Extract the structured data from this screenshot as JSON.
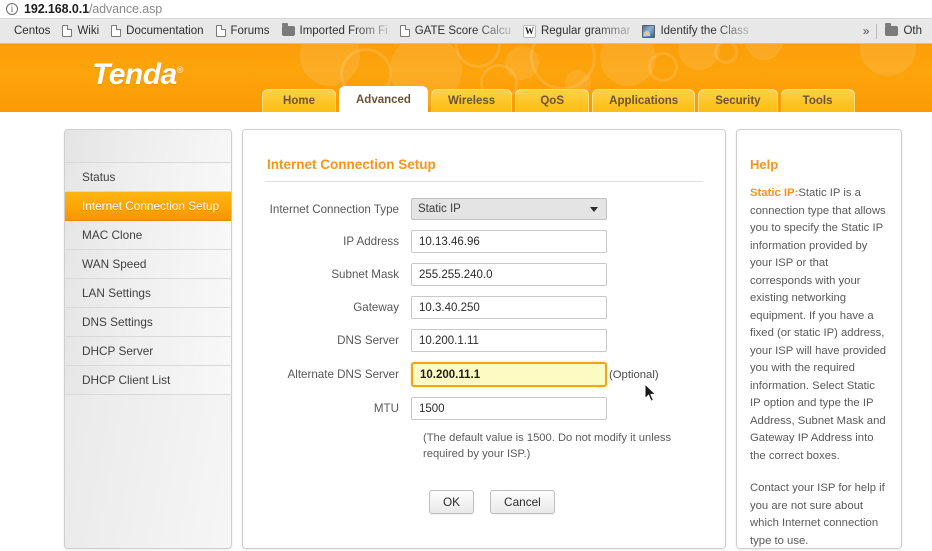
{
  "browser": {
    "url_host": "192.168.0.1",
    "url_path": "/advance.asp",
    "info_icon": "info-circle-icon",
    "bookmarks": [
      {
        "label": "Centos",
        "icon": "none"
      },
      {
        "label": "Wiki",
        "icon": "page-icon"
      },
      {
        "label": "Documentation",
        "icon": "page-icon"
      },
      {
        "label": "Forums",
        "icon": "page-icon"
      },
      {
        "label": "Imported From Fi",
        "icon": "folder-icon",
        "truncated": true
      },
      {
        "label": "GATE Score Calcu",
        "icon": "page-icon",
        "truncated": true
      },
      {
        "label": "Regular grammar",
        "icon": "wikipedia-icon",
        "truncated": true
      },
      {
        "label": "Identify the Class",
        "icon": "photo-icon",
        "truncated": true
      }
    ],
    "overflow_label": "»",
    "other_bookmarks_label": "Oth",
    "other_bookmarks_icon": "folder-icon"
  },
  "header": {
    "logo_text": "Tenda",
    "logo_trademark": "®",
    "tabs": [
      {
        "label": "Home",
        "active": false
      },
      {
        "label": "Advanced",
        "active": true
      },
      {
        "label": "Wireless",
        "active": false
      },
      {
        "label": "QoS",
        "active": false
      },
      {
        "label": "Applications",
        "active": false
      },
      {
        "label": "Security",
        "active": false
      },
      {
        "label": "Tools",
        "active": false
      }
    ]
  },
  "sidebar": {
    "items": [
      {
        "label": "Status",
        "active": false
      },
      {
        "label": "Internet Connection Setup",
        "active": true
      },
      {
        "label": "MAC Clone",
        "active": false
      },
      {
        "label": "WAN Speed",
        "active": false
      },
      {
        "label": "LAN Settings",
        "active": false
      },
      {
        "label": "DNS Settings",
        "active": false
      },
      {
        "label": "DHCP Server",
        "active": false
      },
      {
        "label": "DHCP Client List",
        "active": false
      }
    ]
  },
  "main": {
    "section_title": "Internet Connection Setup",
    "fields": {
      "connection_type": {
        "label": "Internet Connection Type",
        "value": "Static IP",
        "options": [
          "Static IP"
        ]
      },
      "ip_address": {
        "label": "IP Address",
        "value": "10.13.46.96"
      },
      "subnet_mask": {
        "label": "Subnet Mask",
        "value": "255.255.240.0"
      },
      "gateway": {
        "label": "Gateway",
        "value": "10.3.40.250"
      },
      "dns_server": {
        "label": "DNS Server",
        "value": "10.200.1.11"
      },
      "alt_dns": {
        "label": "Alternate DNS Server",
        "value": "10.200.11.1",
        "note": "(Optional)",
        "focused": true
      },
      "mtu": {
        "label": "MTU",
        "value": "1500"
      }
    },
    "mtu_hint": "(The default value is 1500. Do not modify it unless required by your ISP.)",
    "buttons": {
      "ok": "OK",
      "cancel": "Cancel"
    }
  },
  "help": {
    "title": "Help",
    "term": "Static IP:",
    "paragraph1": "Static IP is a connection type that allows you to specify the Static IP information provided by your ISP or that corresponds with your existing networking equipment. If you have a fixed (or static IP) address, your ISP will have provided you with the required information. Select Static IP option and type the IP Address, Subnet Mask and Gateway IP Address into the correct boxes.",
    "paragraph2": "Contact your ISP for help if you are not sure about which Internet connection type to use."
  },
  "colors": {
    "brand_orange": "#f7941d",
    "header_orange": "#fca40c",
    "tab_yellow": "#fdc424",
    "focus_yellow": "#fdfac2",
    "focus_border": "#f0a41c"
  }
}
